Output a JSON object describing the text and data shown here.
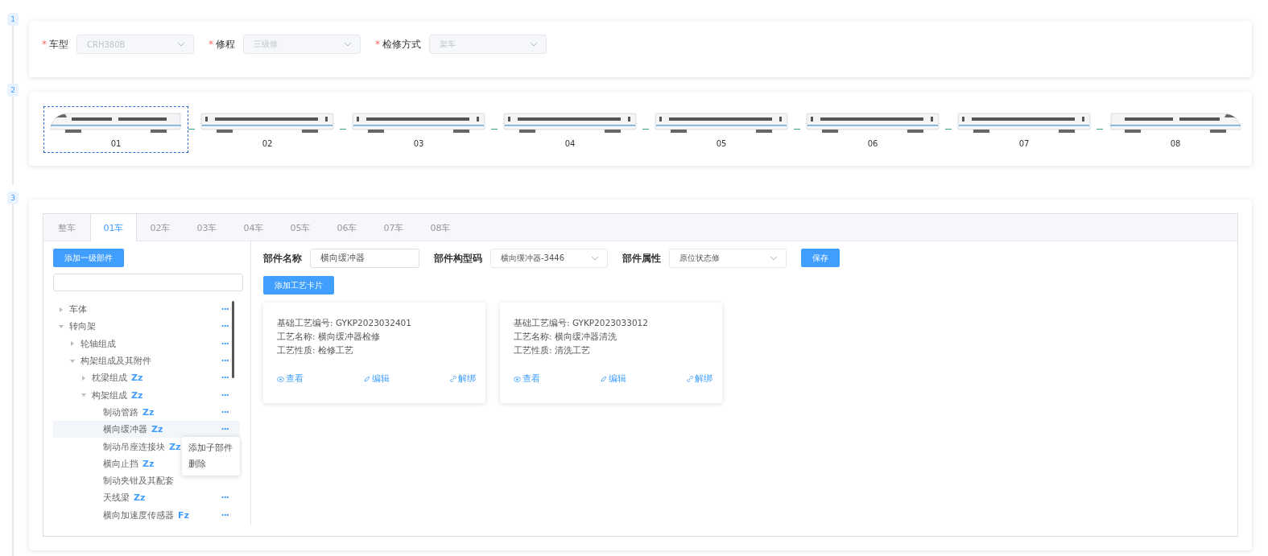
{
  "steps": [
    "1",
    "2",
    "3"
  ],
  "filters": [
    {
      "mark": "*",
      "label": "车型",
      "value": "CRH380B",
      "disabled": true
    },
    {
      "mark": "*",
      "label": "修程",
      "value": "三级修",
      "disabled": true
    },
    {
      "mark": "*",
      "label": "检修方式",
      "value": "架车",
      "disabled": true
    }
  ],
  "cars": [
    {
      "label": "01",
      "kind": "head",
      "selected": true
    },
    {
      "label": "02",
      "kind": "middle",
      "selected": false
    },
    {
      "label": "03",
      "kind": "middle",
      "selected": false
    },
    {
      "label": "04",
      "kind": "middle",
      "selected": false
    },
    {
      "label": "05",
      "kind": "middle",
      "selected": false
    },
    {
      "label": "06",
      "kind": "middle",
      "selected": false
    },
    {
      "label": "07",
      "kind": "middle",
      "selected": false
    },
    {
      "label": "08",
      "kind": "tail",
      "selected": false
    }
  ],
  "tabs": [
    {
      "label": "整车",
      "selected": false
    },
    {
      "label": "01车",
      "selected": true
    },
    {
      "label": "02车",
      "selected": false
    },
    {
      "label": "03车",
      "selected": false
    },
    {
      "label": "04车",
      "selected": false
    },
    {
      "label": "05车",
      "selected": false
    },
    {
      "label": "06车",
      "selected": false
    },
    {
      "label": "07车",
      "selected": false
    },
    {
      "label": "08车",
      "selected": false
    }
  ],
  "tree": {
    "add_button": "添加一级部件",
    "nodes": [
      {
        "label": "车体",
        "expanded": false,
        "selected": false,
        "more": "···"
      },
      {
        "label": "转向架",
        "expanded": true,
        "selected": false,
        "more": "···",
        "children": [
          {
            "label": "轮轴组成",
            "expanded": false,
            "selected": false,
            "more": "···"
          },
          {
            "label": "构架组成及其附件",
            "expanded": true,
            "selected": false,
            "more": "···",
            "children": [
              {
                "label": "枕梁组成",
                "badge": "Zz",
                "expanded": false,
                "selected": false,
                "more": "···"
              },
              {
                "label": "构架组成",
                "badge": "Zz",
                "expanded": true,
                "selected": false,
                "more": "···",
                "children": [
                  {
                    "label": "制动管路",
                    "badge": "Zz",
                    "selected": false,
                    "more": "···"
                  },
                  {
                    "label": "横向缓冲器",
                    "badge": "Zz",
                    "selected": true,
                    "more": "···"
                  },
                  {
                    "label": "制动吊座连接块",
                    "badge": "Zz",
                    "selected": false
                  },
                  {
                    "label": "横向止挡",
                    "badge": "Zz",
                    "selected": false
                  },
                  {
                    "label": "制动夹钳及其配套",
                    "selected": false
                  },
                  {
                    "label": "天线梁",
                    "badge": "Zz",
                    "selected": false,
                    "more": "···"
                  },
                  {
                    "label": "横向加速度传感器",
                    "badge": "Fz",
                    "selected": false,
                    "more": "···"
                  }
                ]
              }
            ]
          }
        ]
      }
    ],
    "context_menu": [
      "添加子部件",
      "删除"
    ]
  },
  "part_form": {
    "fields": [
      {
        "label": "部件名称",
        "kind": "input",
        "value": "横向缓冲器"
      },
      {
        "label": "部件构型码",
        "kind": "select",
        "value": "横向缓冲器-3446"
      },
      {
        "label": "部件属性",
        "kind": "select",
        "value": "原位状态修"
      }
    ],
    "save": "保存",
    "add_card": "添加工艺卡片"
  },
  "process_cards": [
    {
      "lines": [
        "基础工艺编号: GYKP2023032401",
        "工艺名称: 横向缓冲器检修",
        "工艺性质: 检修工艺"
      ],
      "actions": [
        {
          "kind": "view",
          "label": "查看"
        },
        {
          "kind": "edit",
          "label": "编辑"
        },
        {
          "kind": "unbind",
          "label": "解绑"
        }
      ]
    },
    {
      "lines": [
        "基础工艺编号: GYKP2023033012",
        "工艺名称: 横向缓冲器清洗",
        "工艺性质: 清洗工艺"
      ],
      "actions": [
        {
          "kind": "view",
          "label": "查看"
        },
        {
          "kind": "edit",
          "label": "编辑"
        },
        {
          "kind": "unbind",
          "label": "解绑"
        }
      ]
    }
  ]
}
